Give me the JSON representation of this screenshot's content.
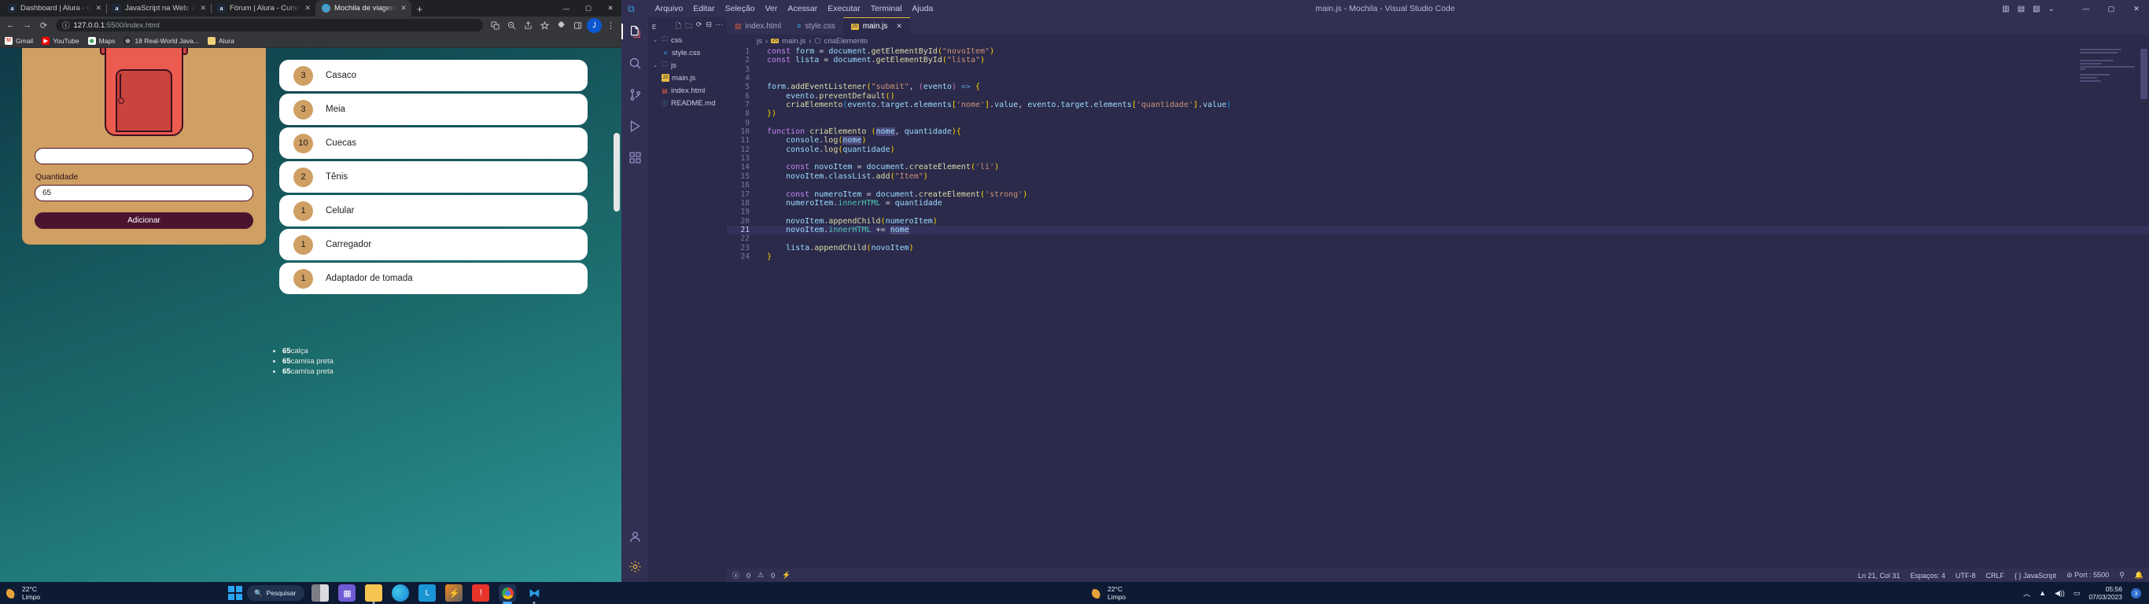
{
  "browser": {
    "tabs": [
      {
        "title": "Dashboard | Alura - Cursos online de tecnologia",
        "icon": "alura-icon",
        "active": false
      },
      {
        "title": "JavaScript na Web: armazenando dados",
        "icon": "alura-icon",
        "active": false
      },
      {
        "title": "Fórum | Alura - Cursos online de tecnologia",
        "icon": "alura-icon",
        "active": false
      },
      {
        "title": "Mochila de viagem",
        "icon": "globe-icon",
        "active": true
      }
    ],
    "new_tab_label": "+",
    "window_controls": {
      "minimize": "—",
      "maximize": "▢",
      "close": "✕"
    },
    "nav": {
      "back": "←",
      "forward": "→",
      "reload": "⟳",
      "info": "ⓘ"
    },
    "omnibox": {
      "host": "127.0.0.1",
      "path": ":5500/index.html"
    },
    "toolbar_icons": [
      "translate-icon",
      "zoom-out-icon",
      "share-icon",
      "bookmark-star-icon",
      "extensions-puzzle-icon",
      "sidebar-panel-icon",
      "profile-avatar",
      "chrome-menu-icon"
    ],
    "profile_initial": "J",
    "bookmarks": [
      {
        "label": "Gmail",
        "icon": "gmail-icon"
      },
      {
        "label": "YouTube",
        "icon": "youtube-icon"
      },
      {
        "label": "Maps",
        "icon": "maps-icon"
      },
      {
        "label": "18 Real-World Java...",
        "icon": "site-icon"
      },
      {
        "label": "Alura",
        "icon": "folder-icon"
      }
    ]
  },
  "page": {
    "form": {
      "quantity_label": "Quantidade",
      "quantity_value": "65",
      "add_button": "Adicionar"
    },
    "items": [
      {
        "qty": "3",
        "name": "Casaco"
      },
      {
        "qty": "3",
        "name": "Meia"
      },
      {
        "qty": "10",
        "name": "Cuecas"
      },
      {
        "qty": "2",
        "name": "Tênis"
      },
      {
        "qty": "1",
        "name": "Celular"
      },
      {
        "qty": "1",
        "name": "Carregador"
      },
      {
        "qty": "1",
        "name": "Adaptador de tomada"
      }
    ],
    "plain_items": [
      {
        "qty": "65",
        "name": "calça"
      },
      {
        "qty": "65",
        "name": "camisa preta"
      },
      {
        "qty": "65",
        "name": "camisa preta"
      }
    ]
  },
  "vscode": {
    "window_title": "main.js - Mochila - Visual Studio Code",
    "menu": [
      "Arquivo",
      "Editar",
      "Seleção",
      "Ver",
      "Acessar",
      "Executar",
      "Terminal",
      "Ajuda"
    ],
    "window_controls": {
      "minimize": "—",
      "maximize": "▢",
      "close": "✕"
    },
    "activity_icons": [
      "explorer-files-icon",
      "search-icon",
      "source-control-icon",
      "run-debug-icon",
      "extensions-icon",
      "account-icon",
      "settings-gear-icon"
    ],
    "explorer": {
      "title": "E",
      "actions": [
        "new-file-icon",
        "new-folder-icon",
        "refresh-icon",
        "collapse-all-icon",
        "more-actions-icon"
      ],
      "tree": [
        {
          "label": "css",
          "type": "folder",
          "depth": 0,
          "expanded": true
        },
        {
          "label": "style.css",
          "type": "css",
          "depth": 1
        },
        {
          "label": "js",
          "type": "folder",
          "depth": 0,
          "expanded": true
        },
        {
          "label": "main.js",
          "type": "js",
          "depth": 1
        },
        {
          "label": "index.html",
          "type": "html",
          "depth": 0
        },
        {
          "label": "README.md",
          "type": "md",
          "depth": 0
        }
      ]
    },
    "editor_tabs": [
      {
        "label": "index.html",
        "icon": "html-icon",
        "active": false
      },
      {
        "label": "style.css",
        "icon": "css-icon",
        "active": false
      },
      {
        "label": "main.js",
        "icon": "js-icon",
        "active": true,
        "close": "✕"
      }
    ],
    "breadcrumb": [
      "js",
      "main.js",
      "criaElemento"
    ],
    "code_lines": [
      {
        "n": 1,
        "text": "const form = document.getElementById(\"novoItem\")"
      },
      {
        "n": 2,
        "text": "const lista = document.getElementById(\"lista\")"
      },
      {
        "n": 3,
        "text": ""
      },
      {
        "n": 4,
        "text": ""
      },
      {
        "n": 5,
        "text": "form.addEventListener(\"submit\", (evento) => {"
      },
      {
        "n": 6,
        "text": "    evento.preventDefault()"
      },
      {
        "n": 7,
        "text": "    criaElemento(evento.target.elements['nome'].value, evento.target.elements['quantidade'].value)"
      },
      {
        "n": 8,
        "text": "})"
      },
      {
        "n": 9,
        "text": ""
      },
      {
        "n": 10,
        "text": "function criaElemento (nome, quantidade){"
      },
      {
        "n": 11,
        "text": "    console.log(nome)"
      },
      {
        "n": 12,
        "text": "    console.log(quantidade)"
      },
      {
        "n": 13,
        "text": ""
      },
      {
        "n": 14,
        "text": "    const novoItem = document.createElement('li')"
      },
      {
        "n": 15,
        "text": "    novoItem.classList.add(\"Item\")"
      },
      {
        "n": 16,
        "text": ""
      },
      {
        "n": 17,
        "text": "    const numeroItem = document.createElement('strong')"
      },
      {
        "n": 18,
        "text": "    numeroItem.innerHTML = quantidade"
      },
      {
        "n": 19,
        "text": ""
      },
      {
        "n": 20,
        "text": "    novoItem.appendChild(numeroItem)"
      },
      {
        "n": 21,
        "text": "    novoItem.innerHTML += nome",
        "highlight": true
      },
      {
        "n": 22,
        "text": ""
      },
      {
        "n": 23,
        "text": "    lista.appendChild(novoItem)"
      },
      {
        "n": 24,
        "text": "}"
      }
    ],
    "statusbar": {
      "errors": "0",
      "warnings": "0",
      "cursor": "Ln 21, Col 31",
      "indent": "Espaços: 4",
      "encoding": "UTF-8",
      "eol": "CRLF",
      "language": "JavaScript",
      "port": "Port : 5500",
      "error_icon": "error-circle-icon",
      "warning_icon": "warning-triangle-icon",
      "radio_icon": "radio-tower-icon",
      "bell_icon": "bell-icon",
      "remote_icon": "remote-window-icon"
    }
  },
  "taskbar": {
    "weather": {
      "temp": "22°C",
      "condition": "Limpo"
    },
    "search_label": "Pesquisar",
    "start_icon": "windows-start-icon",
    "apps": [
      {
        "name": "taskview-icon",
        "running": false,
        "active": false
      },
      {
        "name": "widgets-icon",
        "running": false,
        "active": false
      },
      {
        "name": "file-explorer-icon",
        "running": true,
        "active": false
      },
      {
        "name": "edge-icon",
        "running": false,
        "active": false
      },
      {
        "name": "lightshot-icon",
        "running": false,
        "active": false
      },
      {
        "name": "bolt-app-icon",
        "running": false,
        "active": false
      },
      {
        "name": "avast-icon",
        "running": false,
        "active": false
      },
      {
        "name": "chrome-icon",
        "running": true,
        "active": true
      },
      {
        "name": "vscode-icon",
        "running": true,
        "active": false
      }
    ],
    "tray": {
      "chevron": "︿",
      "wifi_icon": "wifi-icon",
      "volume_icon": "volume-icon",
      "battery_icon": "battery-icon",
      "time": "05:56",
      "date": "07/03/2023",
      "notification_count": "3"
    }
  }
}
